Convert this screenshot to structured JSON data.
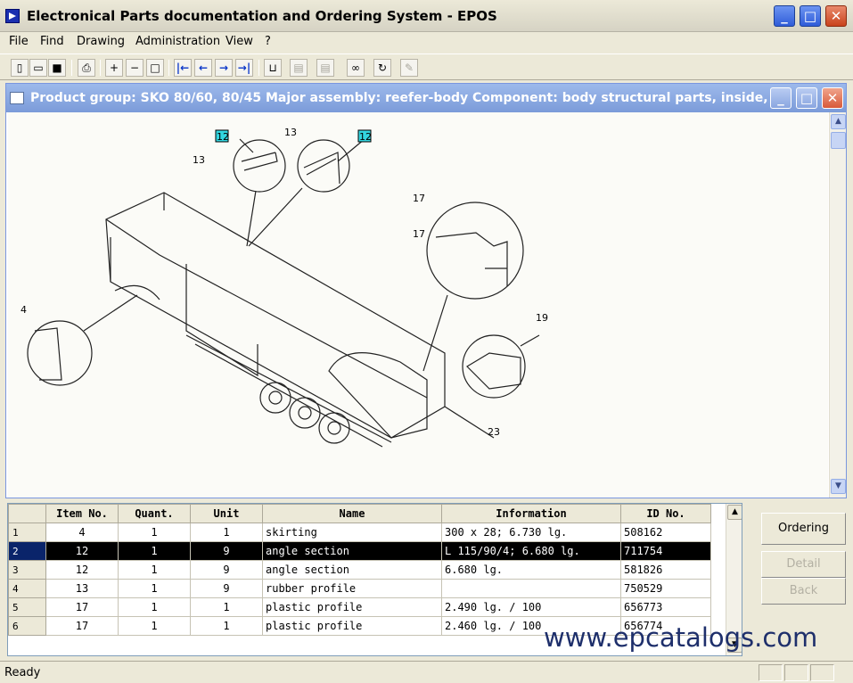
{
  "window": {
    "title": "Electronical Parts documentation and Ordering System - EPOS",
    "minimize": "_",
    "maximize": "□",
    "close": "✕"
  },
  "menu": [
    "File",
    "Find",
    "Drawing",
    "Administration",
    "View",
    "?"
  ],
  "toolbar": {
    "icons": [
      "new-icon",
      "open-icon",
      "save-icon",
      "print-icon",
      "zoom-in-icon",
      "zoom-out-icon",
      "zoom-fit-icon",
      "first-icon",
      "previous-icon",
      "next-icon",
      "last-icon",
      "cart-icon",
      "document-icon",
      "document-icon",
      "binoculars-icon",
      "refresh-icon",
      "pencil-icon"
    ]
  },
  "child_window": {
    "title": "Product group: SKO 80/60,  80/45  Major assembly: reefer-body  Component: body structural parts, inside, ...",
    "minimize": "_",
    "maximize": "□",
    "close": "✕"
  },
  "drawing": {
    "callouts": [
      "12",
      "13",
      "13",
      "12",
      "17",
      "17",
      "4",
      "19",
      "23"
    ]
  },
  "grid": {
    "columns": [
      "Item No.",
      "Quant.",
      "Unit",
      "Name",
      "Information",
      "ID No."
    ],
    "rows": [
      {
        "row": "1",
        "item": "4",
        "quant": "1",
        "unit": "1",
        "name": "skirting",
        "info": "300 x 28; 6.730 lg.",
        "id": "508162"
      },
      {
        "row": "2",
        "item": "12",
        "quant": "1",
        "unit": "9",
        "name": "angle section",
        "info": "L 115/90/4; 6.680 lg.",
        "id": "711754"
      },
      {
        "row": "3",
        "item": "12",
        "quant": "1",
        "unit": "9",
        "name": "angle section",
        "info": "6.680 lg.",
        "id": "581826"
      },
      {
        "row": "4",
        "item": "13",
        "quant": "1",
        "unit": "9",
        "name": "rubber profile",
        "info": "",
        "id": "750529"
      },
      {
        "row": "5",
        "item": "17",
        "quant": "1",
        "unit": "1",
        "name": "plastic profile",
        "info": "2.490 lg. / 100",
        "id": "656773"
      },
      {
        "row": "6",
        "item": "17",
        "quant": "1",
        "unit": "1",
        "name": "plastic profile",
        "info": "2.460 lg. / 100",
        "id": "656774"
      }
    ],
    "selected_row": "2"
  },
  "buttons": {
    "ordering": "Ordering",
    "detail": "Detail",
    "back": "Back"
  },
  "watermark": "www.epcatalogs.com",
  "status": "Ready"
}
